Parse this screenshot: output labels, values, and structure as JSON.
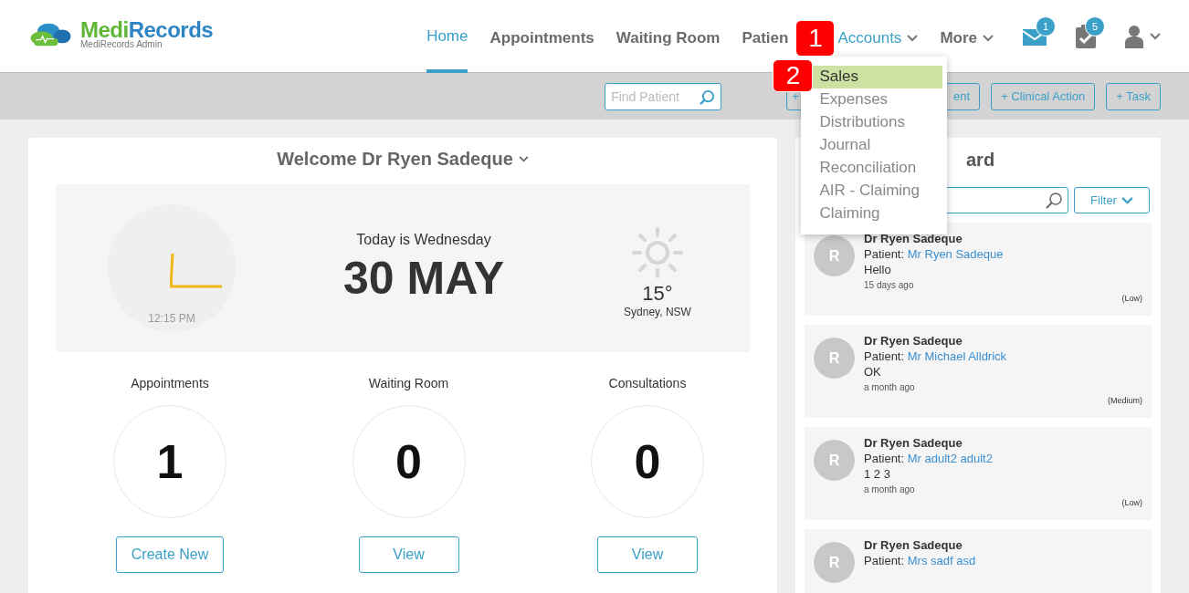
{
  "brand": {
    "name_a": "Medi",
    "name_b": "Records",
    "subtitle": "MediRecords Admin"
  },
  "nav": [
    {
      "label": "Home",
      "selected": true,
      "expanded": false,
      "kind": "link"
    },
    {
      "label": "Appointments",
      "selected": false,
      "expanded": false,
      "kind": "link"
    },
    {
      "label": "Waiting Room",
      "selected": false,
      "expanded": false,
      "kind": "link"
    },
    {
      "label": "Patien",
      "selected": false,
      "expanded": false,
      "kind": "link"
    },
    {
      "label": "Accounts",
      "selected": false,
      "expanded": true,
      "kind": "dropdown"
    },
    {
      "label": "More",
      "selected": false,
      "expanded": false,
      "kind": "dropdown"
    }
  ],
  "nav_icons": [
    {
      "kind": "mail",
      "badge": "1"
    },
    {
      "kind": "tasks",
      "badge": "5"
    },
    {
      "kind": "user"
    }
  ],
  "accounts_menu": [
    {
      "label": "Sales",
      "selected": true
    },
    {
      "label": "Expenses",
      "selected": false
    },
    {
      "label": "Distributions",
      "selected": false
    },
    {
      "label": "Journal",
      "selected": false
    },
    {
      "label": "Reconciliation",
      "selected": false
    },
    {
      "label": "AIR - Claiming",
      "selected": false
    },
    {
      "label": "Claiming",
      "selected": false
    }
  ],
  "callouts": [
    "1",
    "2"
  ],
  "toolbar": {
    "search": {
      "placeholder": "Find Patient"
    },
    "partial_button": {
      "left": "+",
      "right": "ent"
    },
    "buttons": [
      "+ Clinical Action",
      "+ Task"
    ]
  },
  "welcome": {
    "title": "Welcome Dr Ryen Sadeque",
    "time": "12:15 PM",
    "day": "Today is Wednesday",
    "date": "30 MAY",
    "temperature": "15°",
    "location": "Sydney, NSW"
  },
  "stats": [
    {
      "label": "Appointments",
      "value": "1",
      "button": "Create New"
    },
    {
      "label": "Waiting Room",
      "value": "0",
      "button": "View"
    },
    {
      "label": "Consultations",
      "value": "0",
      "button": "View"
    }
  ],
  "board": {
    "title_visible": "ard",
    "filter": "Filter",
    "messages": [
      {
        "initial": "R",
        "author": "Dr Ryen Sadeque",
        "patient_label": "Patient:",
        "patient": "Mr Ryen Sadeque",
        "text": "Hello",
        "time": "15 days ago",
        "priority": "(Low)"
      },
      {
        "initial": "R",
        "author": "Dr Ryen Sadeque",
        "patient_label": "Patient:",
        "patient": "Mr Michael Alldrick",
        "text": "OK",
        "time": "a month ago",
        "priority": "(Medium)"
      },
      {
        "initial": "R",
        "author": "Dr Ryen Sadeque",
        "patient_label": "Patient:",
        "patient": "Mr adult2 adult2",
        "text": "1 2 3",
        "time": "a month ago",
        "priority": "(Low)"
      },
      {
        "initial": "R",
        "author": "Dr Ryen Sadeque",
        "patient_label": "Patient:",
        "patient": "Mrs sadf asd"
      }
    ]
  }
}
